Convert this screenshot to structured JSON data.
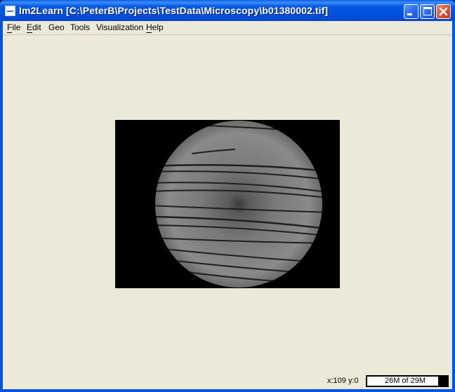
{
  "window": {
    "title": "Im2Learn [C:\\PeterB\\Projects\\TestData\\Microscopy\\b01380002.tif]",
    "titlebar_color": "#0054e3",
    "client_bg": "#ece9d8"
  },
  "menubar": {
    "items": [
      {
        "label": "File"
      },
      {
        "label": "Edit"
      },
      {
        "label": "Geo"
      },
      {
        "label": "Tools"
      },
      {
        "label": "Visualization"
      },
      {
        "label": "Help"
      }
    ]
  },
  "image": {
    "content": "grayscale microscopy image, circular field of view with dark horizontal lines"
  },
  "status": {
    "coords": "x:109 y:0",
    "memory_label": "26M of 29M",
    "memory_fraction": 0.9
  },
  "icons": {
    "app": "app-icon",
    "minimize": "minimize-icon",
    "maximize": "maximize-icon",
    "close": "close-icon"
  }
}
